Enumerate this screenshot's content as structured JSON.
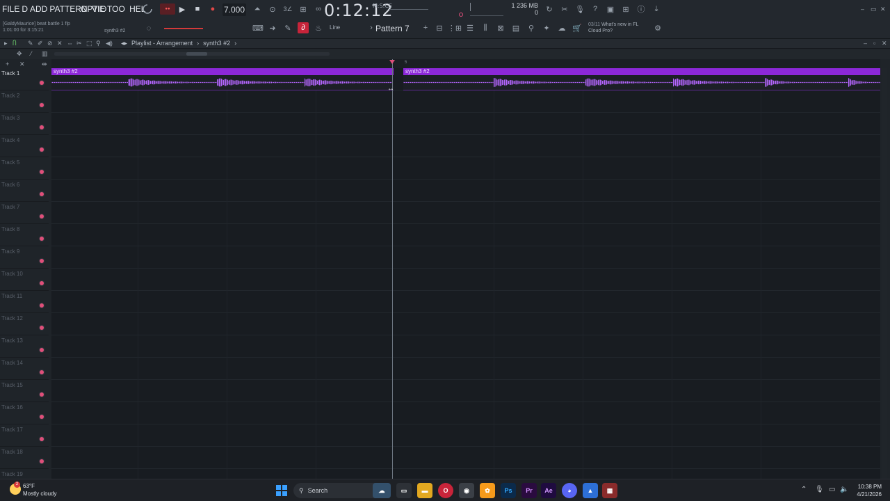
{
  "menu": {
    "file": "FILE",
    "edit": "D",
    "add": "ADD",
    "pattern": "PATTERN",
    "view": "VIE",
    "options": "OPTIO",
    "tools": "TOO",
    "help": "HEL"
  },
  "transport": {
    "tempo": "7.000",
    "time": "0:12:12",
    "time_label": "M:S:CS",
    "mem_top": "1  236 MB",
    "mem_bottom": "0"
  },
  "hint": {
    "line1": "[GaldyMaurice] beat battle 1 flp",
    "line2": "1:01:00 for 3:15:21",
    "synth": "synth3 #2"
  },
  "toolbar": {
    "line_mode": "Line",
    "pattern": "Pattern 7"
  },
  "news": {
    "date": "03/11",
    "line1": "What's new in FL",
    "line2": "Cloud Pro?"
  },
  "playlist": {
    "breadcrumb_a": "Playlist - Arrangement",
    "breadcrumb_b": "synth3 #2",
    "ruler_mark": "5",
    "clips": [
      {
        "title": "synth3 #2"
      },
      {
        "title": "synth3 #2"
      }
    ],
    "tracks": [
      "Track 1",
      "Track 2",
      "Track 3",
      "Track 4",
      "Track 5",
      "Track 6",
      "Track 7",
      "Track 8",
      "Track 9",
      "Track 10",
      "Track 11",
      "Track 12",
      "Track 13",
      "Track 14",
      "Track 15",
      "Track 16",
      "Track 17",
      "Track 18",
      "Track 19"
    ]
  },
  "taskbar": {
    "weather_temp": "63°F",
    "weather_desc": "Mostly cloudy",
    "weather_badge": "2",
    "search": "Search",
    "clock_time": "10:38 PM",
    "clock_date": "4/21/2026"
  },
  "colors": {
    "clip_header": "#8c28d8",
    "waveform": "#b566ff",
    "track_dot": "#e04f7a"
  }
}
